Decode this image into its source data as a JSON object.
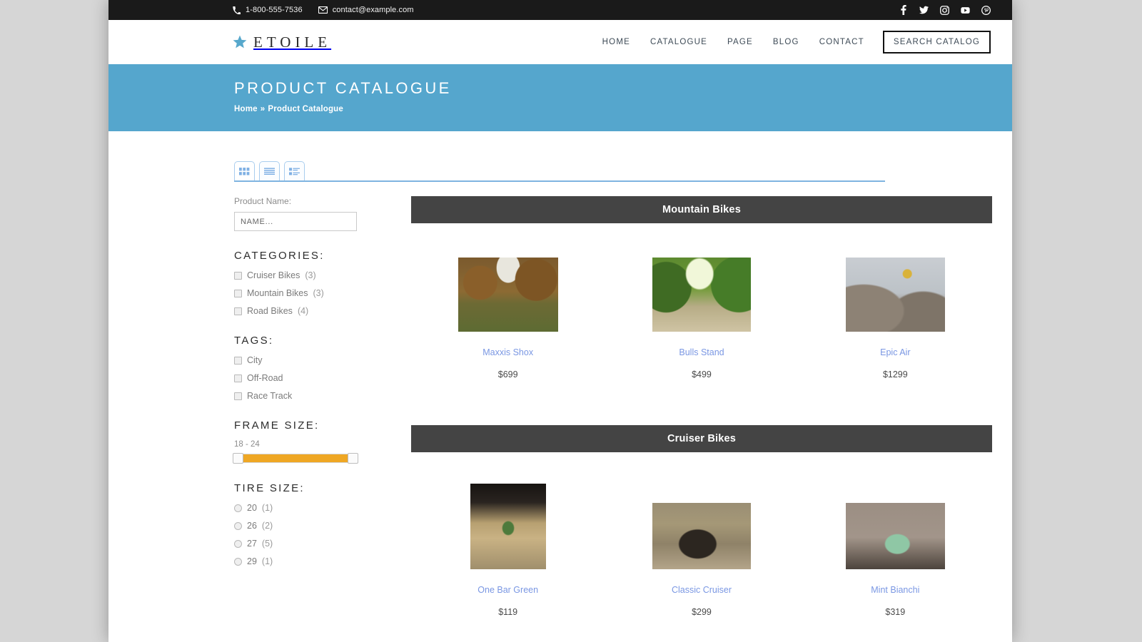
{
  "topbar": {
    "phone": "1-800-555-7536",
    "email": "contact@example.com",
    "social": [
      {
        "name": "facebook-icon",
        "label": "Facebook"
      },
      {
        "name": "twitter-icon",
        "label": "Twitter"
      },
      {
        "name": "instagram-icon",
        "label": "Instagram"
      },
      {
        "name": "youtube-icon",
        "label": "YouTube"
      },
      {
        "name": "pinterest-icon",
        "label": "Pinterest"
      }
    ]
  },
  "header": {
    "logo_text": "ETOILE",
    "nav": [
      {
        "label": "HOME"
      },
      {
        "label": "CATALOGUE"
      },
      {
        "label": "PAGE"
      },
      {
        "label": "BLOG"
      },
      {
        "label": "CONTACT"
      }
    ],
    "search_button": "SEARCH CATALOG"
  },
  "banner": {
    "title": "PRODUCT CATALOGUE",
    "breadcrumb_home": "Home",
    "breadcrumb_sep": "»",
    "breadcrumb_current": "Product Catalogue",
    "background_color": "#55a6cd"
  },
  "view_tabs": [
    {
      "name": "grid-view-tab",
      "active": true
    },
    {
      "name": "list-view-tab",
      "active": false
    },
    {
      "name": "detail-view-tab",
      "active": false
    }
  ],
  "sidebar": {
    "product_name_label": "Product Name:",
    "product_name_value": "",
    "product_name_placeholder": "NAME...",
    "categories_heading": "CATEGORIES:",
    "categories": [
      {
        "label": "Cruiser Bikes",
        "count": "(3)",
        "checked": false
      },
      {
        "label": "Mountain Bikes",
        "count": "(3)",
        "checked": false
      },
      {
        "label": "Road Bikes",
        "count": "(4)",
        "checked": false
      }
    ],
    "tags_heading": "TAGS:",
    "tags": [
      {
        "label": "City",
        "checked": false
      },
      {
        "label": "Off-Road",
        "checked": false
      },
      {
        "label": "Race Track",
        "checked": false
      }
    ],
    "frame_size_heading": "FRAME SIZE:",
    "frame_size_value": "18 - 24",
    "frame_size_min": 18,
    "frame_size_max": 24,
    "slider_color": "#efa724",
    "tire_size_heading": "TIRE SIZE:",
    "tire_sizes": [
      {
        "label": "20",
        "count": "(1)",
        "selected": false
      },
      {
        "label": "26",
        "count": "(2)",
        "selected": false
      },
      {
        "label": "27",
        "count": "(5)",
        "selected": false
      },
      {
        "label": "29",
        "count": "(1)",
        "selected": false
      }
    ]
  },
  "sections": [
    {
      "title": "Mountain Bikes",
      "products": [
        {
          "name": "Maxxis Shox",
          "price": "$699"
        },
        {
          "name": "Bulls Stand",
          "price": "$499"
        },
        {
          "name": "Epic Air",
          "price": "$1299"
        }
      ]
    },
    {
      "title": "Cruiser Bikes",
      "products": [
        {
          "name": "One Bar Green",
          "price": "$119"
        },
        {
          "name": "Classic Cruiser",
          "price": "$299"
        },
        {
          "name": "Mint Bianchi",
          "price": "$319"
        }
      ]
    }
  ]
}
